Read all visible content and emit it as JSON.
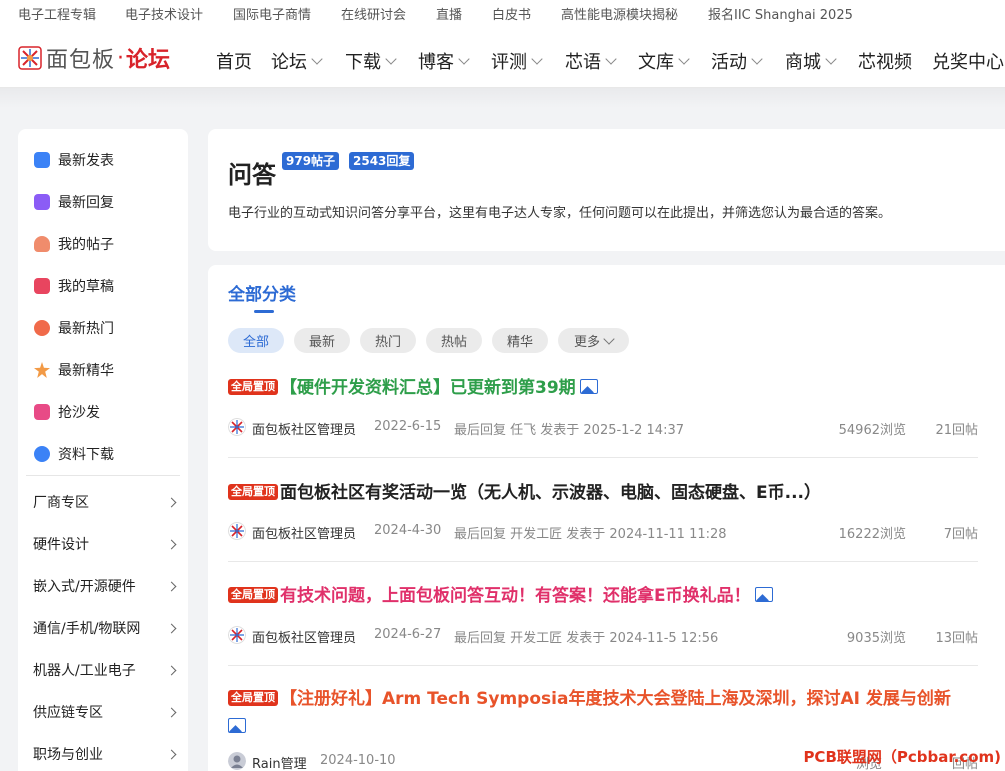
{
  "topbar": {
    "links": [
      "电子工程专辑",
      "电子技术设计",
      "国际电子商情",
      "在线研讨会",
      "直播",
      "白皮书",
      "高性能电源模块揭秘",
      "报名IIC Shanghai 2025"
    ]
  },
  "header": {
    "logo_text": "面包板",
    "logo_dot": "·",
    "logo_forum": "论坛",
    "nav": [
      {
        "label": "首页",
        "dropdown": false
      },
      {
        "label": "论坛",
        "dropdown": true
      },
      {
        "label": "下载",
        "dropdown": true
      },
      {
        "label": "博客",
        "dropdown": true
      },
      {
        "label": "评测",
        "dropdown": true
      },
      {
        "label": "芯语",
        "dropdown": true
      },
      {
        "label": "文库",
        "dropdown": true
      },
      {
        "label": "活动",
        "dropdown": true
      },
      {
        "label": "商城",
        "dropdown": true
      },
      {
        "label": "芯视频",
        "dropdown": false
      },
      {
        "label": "兑奖中心",
        "dropdown": false
      }
    ]
  },
  "sidebar": {
    "quick": [
      {
        "label": "最新发表",
        "icon": "document-icon",
        "color": "#3b82f6"
      },
      {
        "label": "最新回复",
        "icon": "chat-icon",
        "color": "#8b5cf6"
      },
      {
        "label": "我的帖子",
        "icon": "user-icon",
        "color": "#f08c6c"
      },
      {
        "label": "我的草稿",
        "icon": "draft-icon",
        "color": "#e8455f"
      },
      {
        "label": "最新热门",
        "icon": "fire-icon",
        "color": "#f06a4a"
      },
      {
        "label": "最新精华",
        "icon": "star-icon",
        "color": "#f29a46"
      },
      {
        "label": "抢沙发",
        "icon": "sofa-icon",
        "color": "#e84a86"
      },
      {
        "label": "资料下载",
        "icon": "download-icon",
        "color": "#3b82f6"
      }
    ],
    "categories": [
      "厂商专区",
      "硬件设计",
      "嵌入式/开源硬件",
      "通信/手机/物联网",
      "机器人/工业电子",
      "供应链专区",
      "职场与创业"
    ]
  },
  "intro": {
    "title": "问答",
    "posts_badge": "979帖子",
    "replies_badge": "2543回复",
    "description": "电子行业的互动式知识问答分享平台，这里有电子达人专家，任何问题可以在此提出，并筛选您认为最合适的答案。"
  },
  "list": {
    "heading": "全部分类",
    "filters": [
      "全部",
      "最新",
      "热门",
      "热帖",
      "精华",
      "更多"
    ],
    "pin_label": "全局置顶",
    "threads": [
      {
        "title": "【硬件开发资料汇总】已更新到第39期",
        "title_color": "#2e9e4a",
        "has_image": true,
        "author": "面包板社区管理员",
        "date": "2022-6-15",
        "last_reply": "最后回复 任飞 发表于 2025-1-2 14:37",
        "views": "54962浏览",
        "replies": "21回帖"
      },
      {
        "title": "面包板社区有奖活动一览（无人机、示波器、电脑、固态硬盘、E币...）",
        "title_color": "#222222",
        "has_image": false,
        "author": "面包板社区管理员",
        "date": "2024-4-30",
        "last_reply": "最后回复 开发工匠 发表于 2024-11-11 11:28",
        "views": "16222浏览",
        "replies": "7回帖"
      },
      {
        "title": "有技术问题，上面包板问答互动！有答案！还能拿E币换礼品！",
        "title_color": "#e0306a",
        "has_image": true,
        "author": "面包板社区管理员",
        "date": "2024-6-27",
        "last_reply": "最后回复 开发工匠 发表于 2024-11-5 12:56",
        "views": "9035浏览",
        "replies": "13回帖"
      },
      {
        "title": "【注册好礼】Arm Tech Symposia年度技术大会登陆上海及深圳，探讨AI 发展与创新",
        "title_color": "#e8532a",
        "has_image": true,
        "author": "Rain管理",
        "date": "2024-10-10",
        "last_reply": "",
        "views": "浏览",
        "replies": "回帖"
      }
    ]
  },
  "watermark": "PCB联盟网（Pcbbar.com)"
}
